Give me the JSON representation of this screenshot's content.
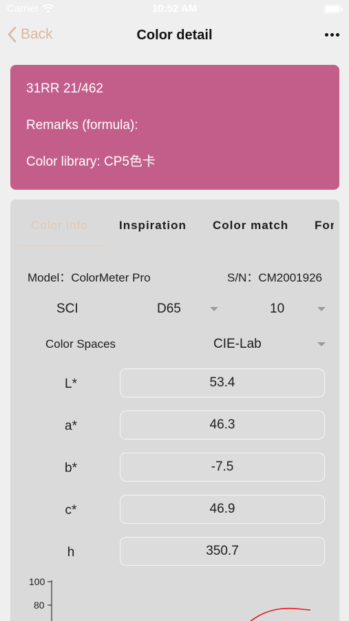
{
  "status_bar": {
    "carrier": "Carrier",
    "time": "10:52 AM"
  },
  "nav": {
    "back_label": "Back",
    "title": "Color detail"
  },
  "color_card": {
    "code": "31RR 21/462",
    "remarks": "Remarks (formula):",
    "library": "Color library: CP5色卡",
    "color": "#c35e8b"
  },
  "tabs": [
    "Color info",
    "Inspiration",
    "Color match",
    "Formula"
  ],
  "active_tab": "Color info",
  "device": {
    "model": "Model：ColorMeter Pro",
    "sn": "S/N：CM2001926"
  },
  "measure": {
    "mode": "SCI",
    "illuminant": "D65",
    "observer": "10"
  },
  "color_space": {
    "label": "Color Spaces",
    "value": "CIE-Lab"
  },
  "fields": [
    {
      "label": "L*",
      "value": "53.4"
    },
    {
      "label": "a*",
      "value": "46.3"
    },
    {
      "label": "b*",
      "value": "-7.5"
    },
    {
      "label": "c*",
      "value": "46.9"
    },
    {
      "label": "h",
      "value": "350.7"
    }
  ],
  "chart": {
    "y_ticks": [
      "100",
      "80"
    ],
    "line_color": "#e8191d"
  },
  "colors": {
    "accent": "#d8b89c",
    "tab_active": "#e3c8b2"
  }
}
